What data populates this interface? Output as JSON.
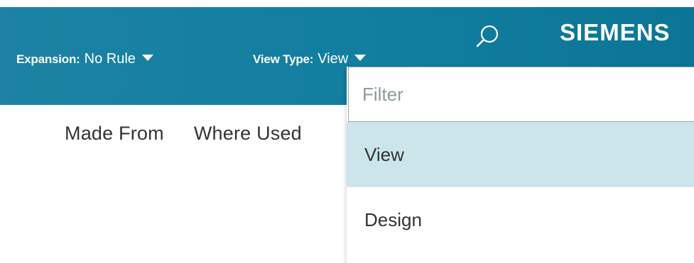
{
  "toolbar": {
    "expansion_label": "Expansion:",
    "expansion_value": "No Rule",
    "view_type_label": "View Type:",
    "view_type_value": "View",
    "brand": "SIEMENS",
    "search_icon": "search-icon"
  },
  "subtabs": [
    {
      "label": "Made From"
    },
    {
      "label": "Where Used"
    }
  ],
  "dropdown": {
    "filter_placeholder": "Filter",
    "filter_value": "",
    "options": [
      {
        "label": "View",
        "selected": true
      },
      {
        "label": "Design",
        "selected": false
      }
    ]
  },
  "colors": {
    "toolbar": "#117ea0",
    "selected_option": "#cce5eb",
    "text": "#333333"
  }
}
